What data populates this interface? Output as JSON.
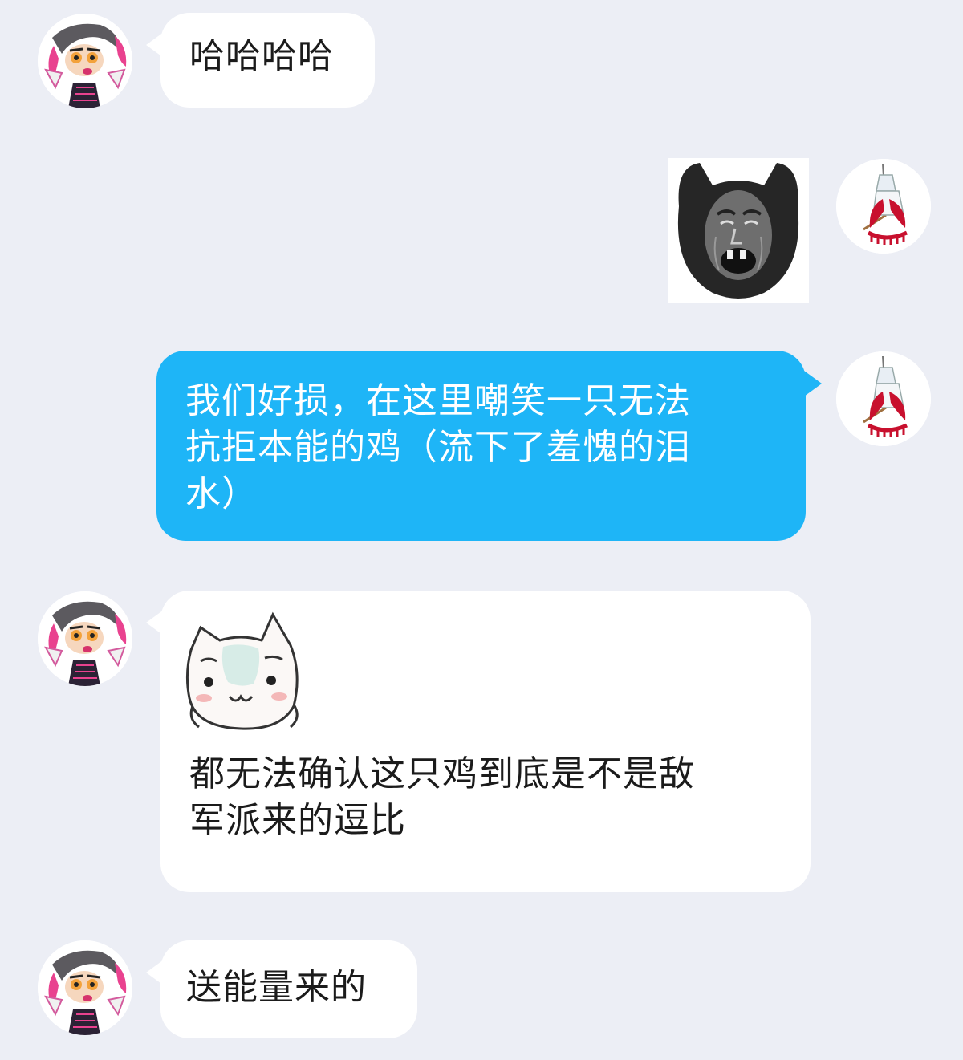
{
  "conversation": {
    "messages": [
      {
        "sender": "other",
        "type": "text",
        "text": "哈哈哈哈"
      },
      {
        "sender": "me",
        "type": "sticker",
        "sticker_icon": "crying-face-sticker-icon"
      },
      {
        "sender": "me",
        "type": "text",
        "text": "我们好损，在这里嘲笑一只无法\n抗拒本能的鸡（流下了羞愧的泪\n水）"
      },
      {
        "sender": "other",
        "type": "sticker-and-text",
        "sticker_icon": "white-cat-sticker-icon",
        "text": "都无法确认这只鸡到底是不是敌\n军派来的逗比"
      },
      {
        "sender": "other",
        "type": "text",
        "text": "送能量来的"
      }
    ]
  },
  "colors": {
    "background": "#eceef5",
    "incoming_bubble": "#ffffff",
    "outgoing_bubble": "#1eb5f7",
    "incoming_text": "#1b1b1b",
    "outgoing_text": "#ffffff"
  },
  "icons": {
    "other_avatar": "squid-girl-avatar-icon",
    "my_avatar": "fan-pinwheel-avatar-icon"
  }
}
